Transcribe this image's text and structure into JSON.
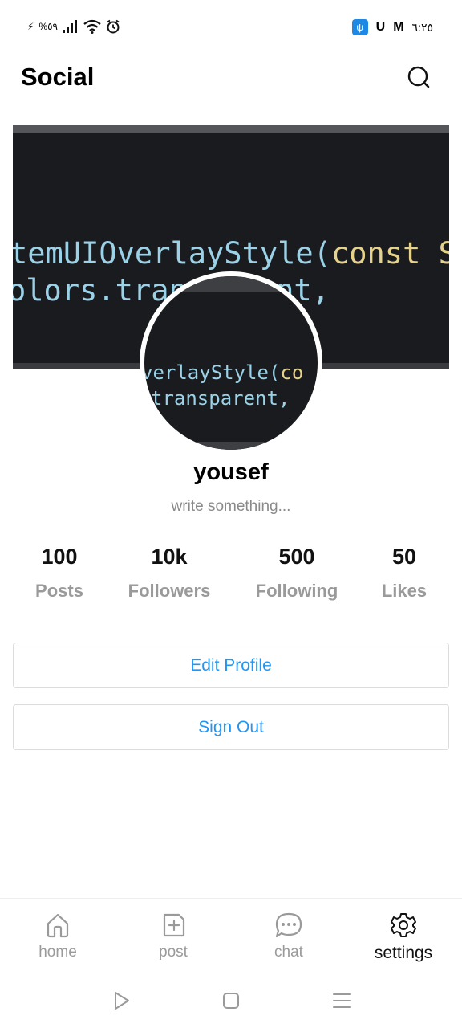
{
  "status_bar": {
    "battery": "%٥٩",
    "time": "٦:٢٥",
    "icons": [
      "charging-icon",
      "signal-icon",
      "wifi-icon",
      "alarm-icon",
      "usb-icon",
      "u-icon",
      "gmail-icon"
    ],
    "left_glyph": "⚡",
    "usb_glyph": "ψ",
    "u_glyph": "U",
    "m_glyph": "M"
  },
  "app_bar": {
    "title": "Social"
  },
  "cover": {
    "line1_plain": "temUIOverlayStyle(",
    "line1_kw": "const Sy",
    "line2": "olors.transparent,"
  },
  "avatar": {
    "line1_plain": "verlayStyle(",
    "line1_kw": "co",
    "line2": "transparent,"
  },
  "profile": {
    "name": "yousef",
    "bio": "write something..."
  },
  "stats": [
    {
      "value": "100",
      "label": "Posts"
    },
    {
      "value": "10k",
      "label": "Followers"
    },
    {
      "value": "500",
      "label": "Following"
    },
    {
      "value": "50",
      "label": "Likes"
    }
  ],
  "actions": {
    "edit_profile": "Edit Profile",
    "sign_out": "Sign Out"
  },
  "bottom_nav": {
    "items": [
      {
        "label": "home",
        "icon": "home-icon"
      },
      {
        "label": "post",
        "icon": "add-post-icon"
      },
      {
        "label": "chat",
        "icon": "chat-icon"
      },
      {
        "label": "settings",
        "icon": "settings-icon"
      }
    ],
    "active": "settings"
  },
  "colors": {
    "accent": "#2196f3",
    "muted": "#9a9a9a",
    "cover_bg": "#1a1b1e",
    "code_text": "#9bd2e8",
    "code_keyword": "#e6d28a"
  }
}
